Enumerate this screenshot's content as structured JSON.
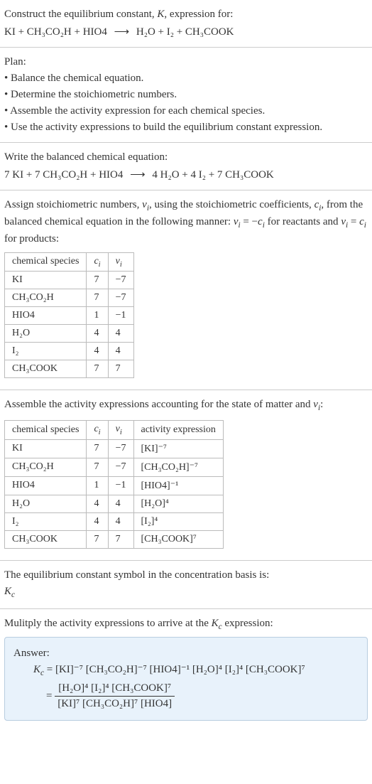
{
  "s1": {
    "title_line": "Construct the equilibrium constant, K, expression for:",
    "equation_left": "KI + CH₃CO₂H + HIO4",
    "arrow": "⟶",
    "equation_right": "H₂O + I₂ + CH₃COOK"
  },
  "s2": {
    "plan_label": "Plan:",
    "b1": "• Balance the chemical equation.",
    "b2": "• Determine the stoichiometric numbers.",
    "b3": "• Assemble the activity expression for each chemical species.",
    "b4": "• Use the activity expressions to build the equilibrium constant expression."
  },
  "s3": {
    "line1": "Write the balanced chemical equation:",
    "eq_left": "7 KI + 7 CH₃CO₂H + HIO4",
    "arrow": "⟶",
    "eq_right": "4 H₂O + 4 I₂ + 7 CH₃COOK"
  },
  "s4": {
    "intro1": "Assign stoichiometric numbers, νᵢ, using the stoichiometric coefficients, cᵢ, from the balanced chemical equation in the following manner: νᵢ = −cᵢ for reactants and νᵢ = cᵢ for products:",
    "h_species": "chemical species",
    "h_ci": "cᵢ",
    "h_vi": "νᵢ",
    "r1s": "KI",
    "r1c": "7",
    "r1v": "−7",
    "r2s": "CH₃CO₂H",
    "r2c": "7",
    "r2v": "−7",
    "r3s": "HIO4",
    "r3c": "1",
    "r3v": "−1",
    "r4s": "H₂O",
    "r4c": "4",
    "r4v": "4",
    "r5s": "I₂",
    "r5c": "4",
    "r5v": "4",
    "r6s": "CH₃COOK",
    "r6c": "7",
    "r6v": "7"
  },
  "s5": {
    "intro": "Assemble the activity expressions accounting for the state of matter and νᵢ:",
    "h_species": "chemical species",
    "h_ci": "cᵢ",
    "h_vi": "νᵢ",
    "h_act": "activity expression",
    "r1s": "KI",
    "r1c": "7",
    "r1v": "−7",
    "r1a": "[KI]⁻⁷",
    "r2s": "CH₃CO₂H",
    "r2c": "7",
    "r2v": "−7",
    "r2a": "[CH₃CO₂H]⁻⁷",
    "r3s": "HIO4",
    "r3c": "1",
    "r3v": "−1",
    "r3a": "[HIO4]⁻¹",
    "r4s": "H₂O",
    "r4c": "4",
    "r4v": "4",
    "r4a": "[H₂O]⁴",
    "r5s": "I₂",
    "r5c": "4",
    "r5v": "4",
    "r5a": "[I₂]⁴",
    "r6s": "CH₃COOK",
    "r6c": "7",
    "r6v": "7",
    "r6a": "[CH₃COOK]⁷"
  },
  "s6": {
    "line1": "The equilibrium constant symbol in the concentration basis is:",
    "symbol": "K_c"
  },
  "s7": {
    "line1": "Mulitply the activity expressions to arrive at the K_c expression:"
  },
  "answer": {
    "label": "Answer:",
    "kc": "K_c",
    "eq1": "= [KI]⁻⁷ [CH₃CO₂H]⁻⁷ [HIO4]⁻¹ [H₂O]⁴ [I₂]⁴ [CH₃COOK]⁷",
    "eq2_eq": "=",
    "num": "[H₂O]⁴ [I₂]⁴ [CH₃COOK]⁷",
    "den": "[KI]⁷ [CH₃CO₂H]⁷ [HIO4]"
  }
}
